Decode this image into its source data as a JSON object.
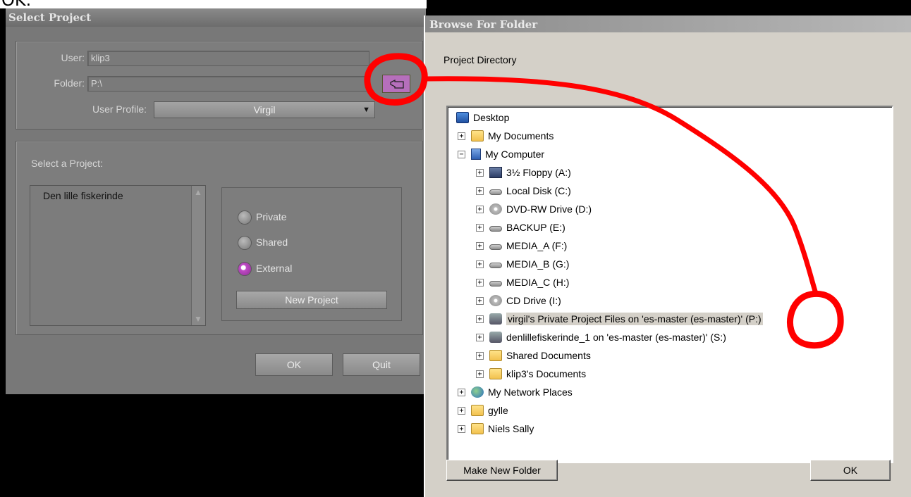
{
  "top_strip": {
    "text": "OK."
  },
  "select_project": {
    "title": "Select Project",
    "user_label": "User:",
    "user_value": "klip3",
    "folder_label": "Folder:",
    "folder_value": "P:\\",
    "profile_label": "User Profile:",
    "profile_value": "Virgil",
    "select_label": "Select a Project:",
    "projects": [
      "Den lille fiskerinde"
    ],
    "radios": [
      {
        "label": "Private",
        "selected": false
      },
      {
        "label": "Shared",
        "selected": false
      },
      {
        "label": "External",
        "selected": true
      }
    ],
    "new_project": "New Project",
    "ok": "OK",
    "quit": "Quit"
  },
  "browse": {
    "title": "Browse For Folder",
    "prompt": "Project Directory",
    "tree": [
      {
        "label": "Desktop",
        "icon": "desktop-icon",
        "level": 0,
        "expander": ""
      },
      {
        "label": "My Documents",
        "icon": "folder-icon",
        "level": 1,
        "expander": "+"
      },
      {
        "label": "My Computer",
        "icon": "computer-icon",
        "level": 1,
        "expander": "−"
      },
      {
        "label": "3½ Floppy (A:)",
        "icon": "floppy-icon",
        "level": 2,
        "expander": "+"
      },
      {
        "label": "Local Disk (C:)",
        "icon": "drive-icon",
        "level": 2,
        "expander": "+"
      },
      {
        "label": "DVD-RW Drive (D:)",
        "icon": "disc-icon",
        "level": 2,
        "expander": "+"
      },
      {
        "label": "BACKUP (E:)",
        "icon": "drive-icon",
        "level": 2,
        "expander": "+"
      },
      {
        "label": "MEDIA_A (F:)",
        "icon": "drive-icon",
        "level": 2,
        "expander": "+"
      },
      {
        "label": "MEDIA_B (G:)",
        "icon": "drive-icon",
        "level": 2,
        "expander": "+"
      },
      {
        "label": "MEDIA_C (H:)",
        "icon": "drive-icon",
        "level": 2,
        "expander": "+"
      },
      {
        "label": "CD Drive (I:)",
        "icon": "disc-icon",
        "level": 2,
        "expander": "+"
      },
      {
        "label": "virgil's Private Project Files on 'es-master (es-master)' (P:)",
        "icon": "network-drive-icon",
        "level": 2,
        "expander": "+",
        "selected": true
      },
      {
        "label": "denlillefiskerinde_1 on 'es-master (es-master)' (S:)",
        "icon": "network-drive-icon",
        "level": 2,
        "expander": "+"
      },
      {
        "label": "Shared Documents",
        "icon": "folder-icon",
        "level": 2,
        "expander": "+"
      },
      {
        "label": "klip3's Documents",
        "icon": "folder-icon",
        "level": 2,
        "expander": "+"
      },
      {
        "label": "My Network Places",
        "icon": "network-icon",
        "level": 1,
        "expander": "+"
      },
      {
        "label": "gylle",
        "icon": "folder-icon",
        "level": 1,
        "expander": "+"
      },
      {
        "label": "Niels Sally",
        "icon": "folder-icon",
        "level": 1,
        "expander": "+"
      }
    ],
    "make_new_folder": "Make New Folder",
    "ok": "OK"
  },
  "colors": {
    "annotation": "#ff0000",
    "avid_gray": "#787878",
    "radio_accent": "#c04cc6"
  }
}
